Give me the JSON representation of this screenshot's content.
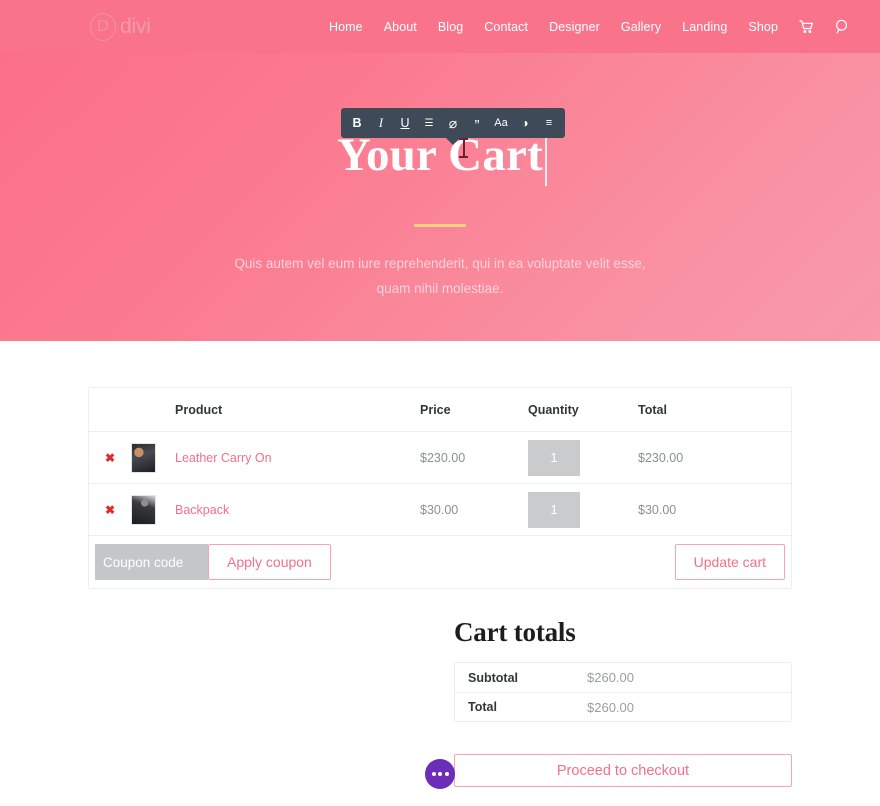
{
  "header": {
    "logo": {
      "mark": "D",
      "text": "divi"
    },
    "nav": [
      {
        "label": "Home"
      },
      {
        "label": "About"
      },
      {
        "label": "Blog"
      },
      {
        "label": "Contact"
      },
      {
        "label": "Designer"
      },
      {
        "label": "Gallery"
      },
      {
        "label": "Landing"
      },
      {
        "label": "Shop"
      }
    ],
    "icons": [
      {
        "name": "cart-icon",
        "glyph": "🛒"
      },
      {
        "name": "search-icon",
        "glyph": "⌕"
      }
    ],
    "background_color": "#f9748a"
  },
  "hero": {
    "title": "Your Cart",
    "subtitle": "Quis autem vel eum iure reprehenderit, qui in ea voluptate velit esse, quam nihil molestiae.",
    "divider_color": "#ffd07a",
    "gradient_from": "#fb6f89",
    "gradient_to": "#f79aac"
  },
  "editor_toolbar": {
    "buttons": [
      {
        "name": "bold-icon",
        "glyph": "B",
        "label": "Bold"
      },
      {
        "name": "italic-icon",
        "glyph": "I",
        "label": "Italic"
      },
      {
        "name": "underline-icon",
        "glyph": "U",
        "label": "Underline"
      },
      {
        "name": "align-icon",
        "glyph": "☰",
        "label": "Align"
      },
      {
        "name": "unlink-icon",
        "glyph": "⌀",
        "label": "Link"
      },
      {
        "name": "quote-icon",
        "glyph": "”",
        "label": "Quote"
      },
      {
        "name": "text-size-icon",
        "glyph": "Aa",
        "label": "Text size"
      },
      {
        "name": "text-color-icon",
        "glyph": "◑",
        "label": "Text color"
      },
      {
        "name": "list-icon",
        "glyph": "≡",
        "label": "List"
      }
    ],
    "background_color": "#3e4a57"
  },
  "cart": {
    "columns": [
      "Product",
      "Price",
      "Quantity",
      "Total"
    ],
    "remove_glyph": "✖",
    "items": [
      {
        "name": "Leather Carry On",
        "price": "$230.00",
        "quantity": "1",
        "total": "$230.00"
      },
      {
        "name": "Backpack",
        "price": "$30.00",
        "quantity": "1",
        "total": "$30.00"
      }
    ],
    "coupon_placeholder": "Coupon code",
    "coupon_value": "",
    "apply_coupon_label": "Apply coupon",
    "update_cart_label": "Update cart",
    "link_color": "#f37089"
  },
  "totals": {
    "title": "Cart totals",
    "rows": [
      {
        "label": "Subtotal",
        "value": "$260.00"
      },
      {
        "label": "Total",
        "value": "$260.00"
      }
    ],
    "checkout_label": "Proceed to checkout"
  },
  "fab": {
    "name": "divi-builder-menu",
    "color": "#6c2eb9"
  }
}
